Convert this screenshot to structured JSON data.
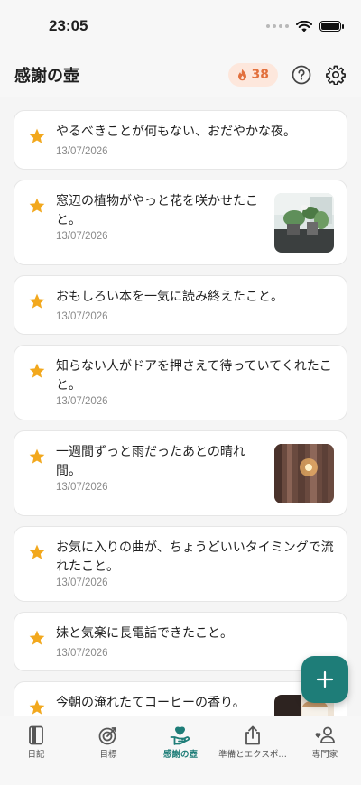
{
  "status_bar": {
    "time": "23:05"
  },
  "header": {
    "title": "感謝の壺",
    "streak_count": "38"
  },
  "entries": [
    {
      "text": "やるべきことが何もない、おだやかな夜。",
      "date": "13/07/2026"
    },
    {
      "text": "窓辺の植物がやっと花を咲かせたこと。",
      "date": "13/07/2026"
    },
    {
      "text": "おもしろい本を一気に読み終えたこと。",
      "date": "13/07/2026"
    },
    {
      "text": "知らない人がドアを押さえて待っていてくれたこと。",
      "date": "13/07/2026"
    },
    {
      "text": "一週間ずっと雨だったあとの晴れ間。",
      "date": "13/07/2026"
    },
    {
      "text": "お気に入りの曲が、ちょうどいいタイミングで流れたこと。",
      "date": "13/07/2026"
    },
    {
      "text": "妹と気楽に長電話できたこと。",
      "date": "13/07/2026"
    },
    {
      "text": "今朝の淹れたてコーヒーの香り。",
      "date": ""
    }
  ],
  "tabs": [
    {
      "label": "日記",
      "icon": "journal-icon"
    },
    {
      "label": "目標",
      "icon": "target-icon"
    },
    {
      "label": "感謝の壺",
      "icon": "gratitude-jar-icon"
    },
    {
      "label": "準備とエクスポ…",
      "icon": "share-export-icon"
    },
    {
      "label": "専門家",
      "icon": "experts-icon"
    }
  ],
  "colors": {
    "accent": "#1e7d78",
    "star": "#f2a81d",
    "streak_bg": "#fde7dc",
    "streak_text": "#e2703d"
  }
}
